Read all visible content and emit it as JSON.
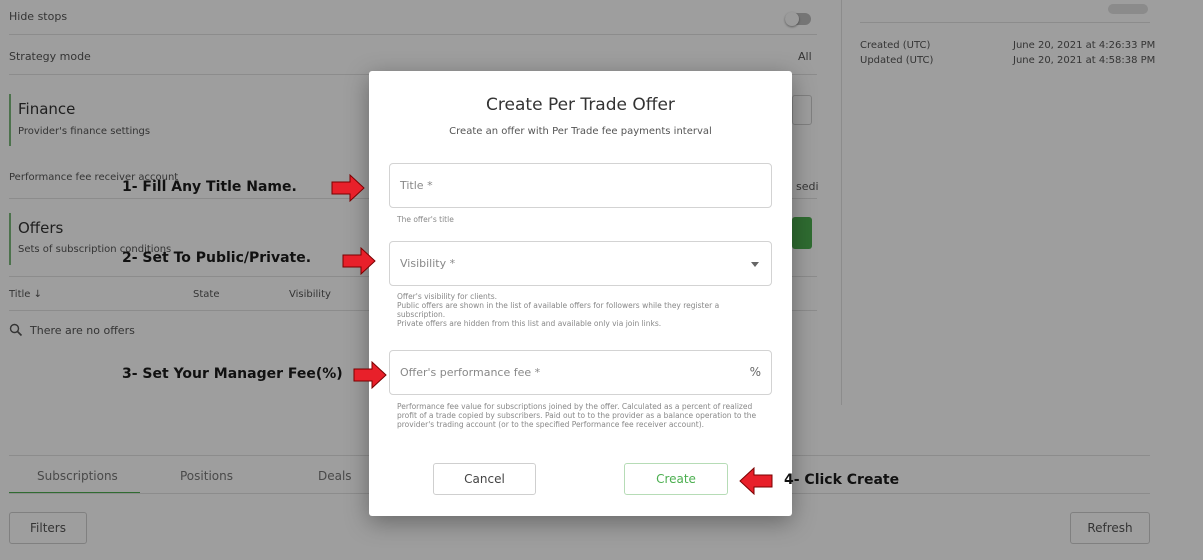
{
  "background": {
    "hide_stops_label": "Hide stops",
    "strategy_mode_label": "Strategy mode",
    "strategy_mode_value": "All",
    "finance": {
      "title": "Finance",
      "subtitle": "Provider's finance settings"
    },
    "perf_fee_receiver_label": "Performance fee receiver account",
    "perf_fee_receiver_value_fragment": "sedi",
    "offers": {
      "title": "Offers",
      "subtitle": "Sets of subscription conditions",
      "columns": [
        "Title ↓",
        "State",
        "Visibility"
      ],
      "empty_text": "There are no offers"
    },
    "info": {
      "created_label": "Created (UTC)",
      "created_value": "June 20, 2021 at 4:26:33 PM",
      "updated_label": "Updated (UTC)",
      "updated_value": "June 20, 2021 at 4:58:38 PM"
    },
    "tabs": [
      "Subscriptions",
      "Positions",
      "Deals"
    ],
    "filters_button": "Filters",
    "refresh_button": "Refresh"
  },
  "modal": {
    "title": "Create Per Trade Offer",
    "subtitle": "Create an offer with Per Trade fee payments interval",
    "title_field": {
      "placeholder": "Title *",
      "helper": "The offer's title"
    },
    "visibility_field": {
      "placeholder": "Visibility *",
      "helper": "Offer's visibility for clients.\nPublic offers are shown in the list of available offers for followers while they register a subscription.\nPrivate offers are hidden from this list and available only via join links."
    },
    "fee_field": {
      "placeholder": "Offer's performance fee *",
      "suffix": "%",
      "helper": "Performance fee value for subscriptions joined by the offer. Calculated as a percent of realized profit of a trade copied by subscribers. Paid out to to the provider as a balance operation to the provider's trading account (or to the specified Performance fee receiver account)."
    },
    "cancel_button": "Cancel",
    "create_button": "Create"
  },
  "annotations": {
    "step1": "1- Fill Any Title Name.",
    "step2": "2- Set To Public/Private.",
    "step3": "3- Set Your Manager Fee(%)",
    "step4": "4- Click Create"
  },
  "colors": {
    "accent_green": "#4caf50",
    "arrow_red": "#e8202a",
    "overlay": "rgba(0,0,0,0.38)"
  }
}
